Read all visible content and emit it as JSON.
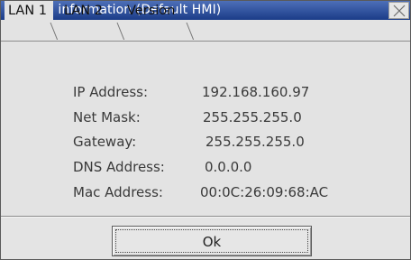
{
  "window": {
    "title": "System information (Default HMI)",
    "title_bar_color": "#2a4c98"
  },
  "tabs": [
    {
      "label": "LAN 1",
      "active": true
    },
    {
      "label": "LAN 2",
      "active": false
    },
    {
      "label": "Version",
      "active": false
    }
  ],
  "info": {
    "ip_label": "IP Address:",
    "ip_value": "192.168.160.97",
    "mask_label": "Net Mask:",
    "mask_value": "255.255.255.0",
    "gateway_label": "Gateway:",
    "gateway_value": "255.255.255.0",
    "dns_label": "DNS Address:",
    "dns_value": "0.0.0.0",
    "mac_label": "Mac Address:",
    "mac_value": "00:0C:26:09:68:AC"
  },
  "buttons": {
    "ok_label": "Ok"
  },
  "icons": {
    "close": "close-icon"
  }
}
